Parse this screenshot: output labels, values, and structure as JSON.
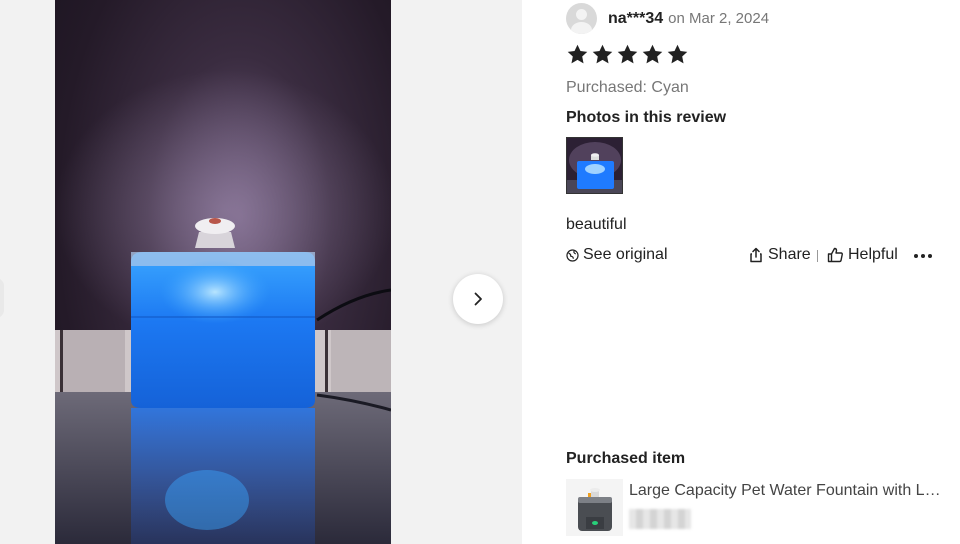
{
  "review": {
    "username": "na***34",
    "date": "on Mar 2, 2024",
    "rating": 5,
    "purchased_variant": "Purchased: Cyan",
    "photos_heading": "Photos in this review",
    "text": "beautiful",
    "actions": {
      "see_original": "See original",
      "share": "Share",
      "helpful": "Helpful"
    }
  },
  "purchased_item": {
    "heading": "Purchased item",
    "title": "Large Capacity Pet Water Fountain with LED Light"
  },
  "icons": {
    "next": "chevron-right-icon",
    "star": "star-icon",
    "globe": "globe-icon",
    "share": "share-icon",
    "helpful": "thumbs-up-icon",
    "more": "more-icon"
  },
  "colors": {
    "star": "#222222",
    "fountain_glow": "#1f7bff"
  }
}
